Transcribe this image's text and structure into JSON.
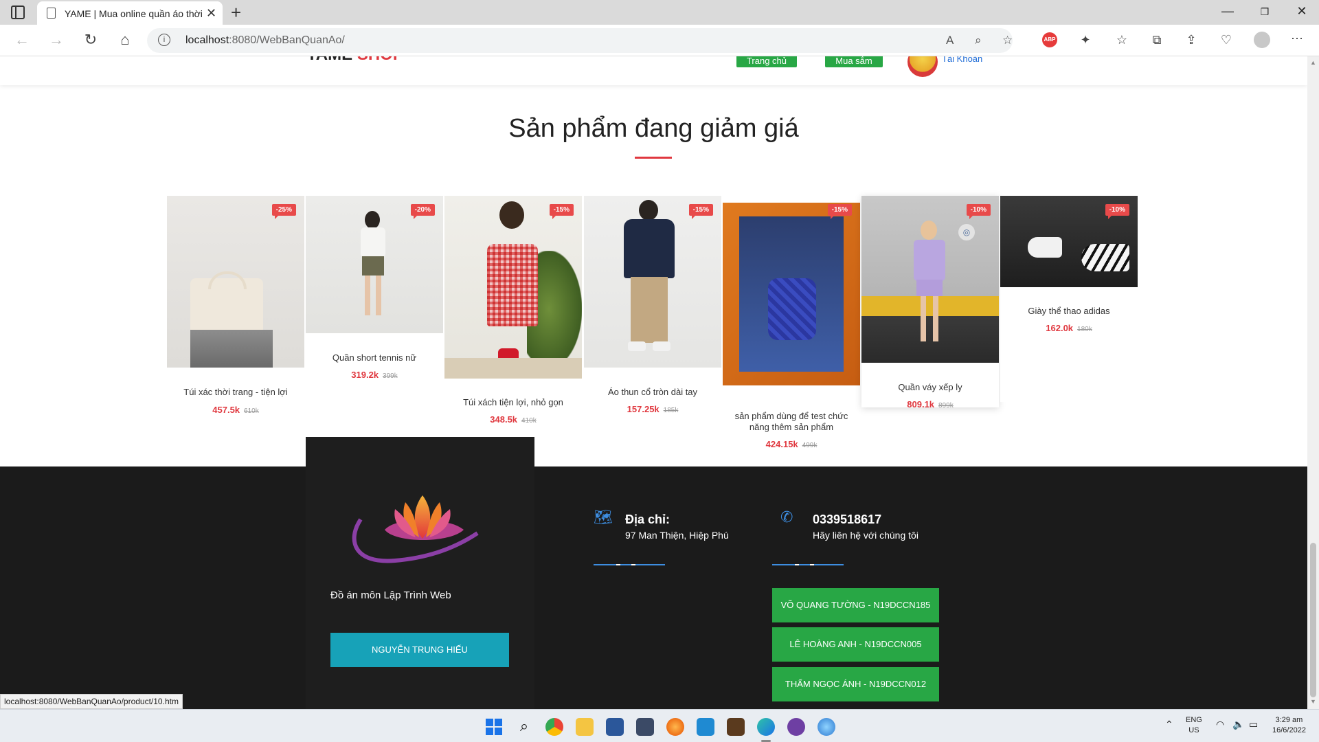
{
  "browser": {
    "tab_title": "YAME | Mua online quần áo thời",
    "url_host": "localhost",
    "url_path": ":8080/WebBanQuanAo/",
    "status_url": "localhost:8080/WebBanQuanAo/product/10.htm",
    "icons": [
      "sidebar-icon",
      "page-icon",
      "close-icon",
      "plus-icon",
      "back-icon",
      "forward-icon",
      "refresh-icon",
      "home-icon",
      "info-icon",
      "read-aloud-icon",
      "zoom-icon",
      "favorite-add-icon",
      "adblock-icon",
      "extensions-icon",
      "favorites-icon",
      "collections-icon",
      "share-icon",
      "profile-icon",
      "more-icon"
    ]
  },
  "header": {
    "logo_main": "YAME",
    "logo_accent": "SHOP",
    "nav_home": "Trang chủ",
    "nav_shop": "Mua sắm",
    "account": "Tài Khoản"
  },
  "section": {
    "title": "Sản phẩm đang giảm giá"
  },
  "products": [
    {
      "name": "Túi xác thời trang - tiện lợi",
      "price": "457.5k",
      "old_price": "610k",
      "discount": "-25%"
    },
    {
      "name": "Quần short tennis nữ",
      "price": "319.2k",
      "old_price": "399k",
      "discount": "-20%"
    },
    {
      "name": "Túi xách tiện lợi, nhỏ gọn",
      "price": "348.5k",
      "old_price": "410k",
      "discount": "-15%"
    },
    {
      "name": "Áo thun cổ tròn dài tay",
      "price": "157.25k",
      "old_price": "185k",
      "discount": "-15%"
    },
    {
      "name": "sản phẩm dùng để test chức năng thêm sản phẩm",
      "price": "424.15k",
      "old_price": "499k",
      "discount": "-15%"
    },
    {
      "name": "Quần váy xếp ly",
      "price": "809.1k",
      "old_price": "899k",
      "discount": "-10%"
    },
    {
      "name": "Giày thể thao adidas",
      "price": "162.0k",
      "old_price": "180k",
      "discount": "-10%"
    }
  ],
  "footer": {
    "description": "Đồ án môn Lập Trình Web",
    "leader_button": "NGUYỄN TRUNG HIẾU",
    "address_title": "Địa chỉ:",
    "address_value": "97 Man Thiện, Hiệp Phú",
    "phone_title": "0339518617",
    "phone_sub": "Hãy liên hệ với chúng tôi",
    "members": [
      "VÕ QUANG TƯỜNG - N19DCCN185",
      "LÊ HOÀNG ANH - N19DCCN005",
      "THẨM NGỌC ÁNH - N19DCCN012"
    ]
  },
  "taskbar": {
    "lang": "ENG",
    "region": "US",
    "time": "3:29 am",
    "date": "16/6/2022"
  },
  "colors": {
    "accent_red": "#e0383f",
    "green": "#28a745",
    "teal": "#17a2b8",
    "footer_bg": "#1b1b1b"
  }
}
